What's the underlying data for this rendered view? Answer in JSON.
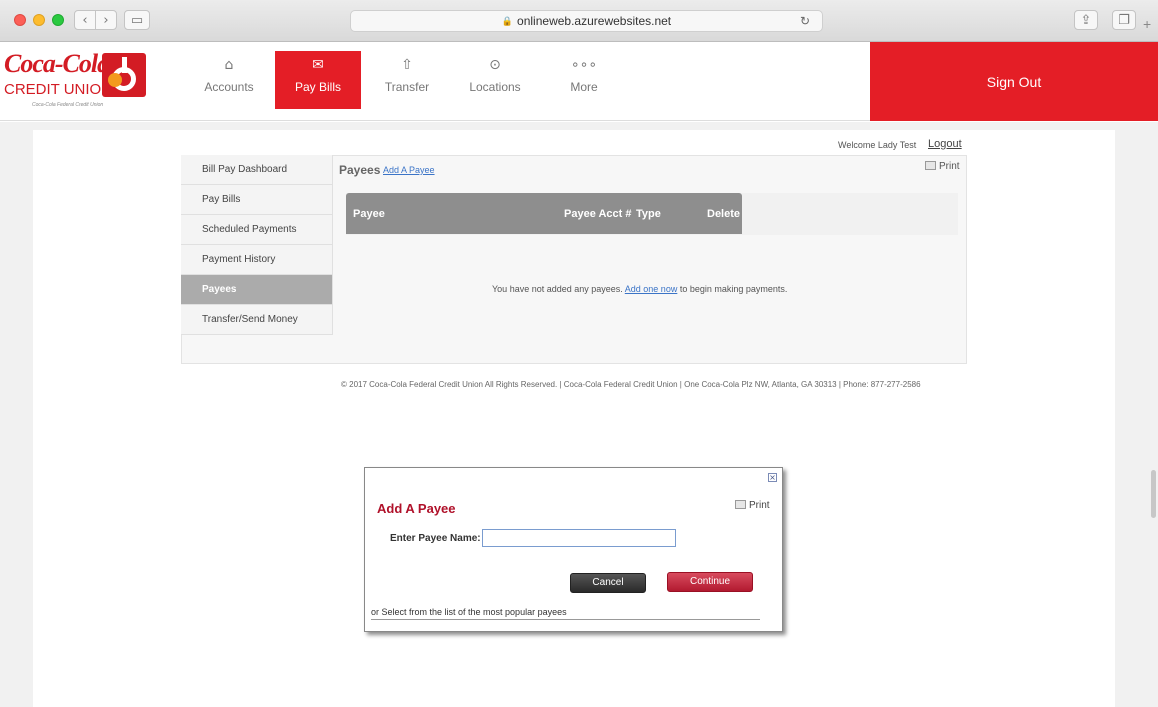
{
  "browser": {
    "url": "onlineweb.azurewebsites.net"
  },
  "header": {
    "logo_script": "Coca-Cola",
    "logo_cu": "CREDIT UNION",
    "logo_fcu": "Coca-Cola Federal Credit Union",
    "nav": [
      {
        "label": "Accounts",
        "icon": "home-icon"
      },
      {
        "label": "Pay Bills",
        "icon": "envelope-icon"
      },
      {
        "label": "Transfer",
        "icon": "upload-icon"
      },
      {
        "label": "Locations",
        "icon": "location-pin-icon"
      },
      {
        "label": "More",
        "icon": "more-dots-icon"
      }
    ],
    "sign_out": "Sign Out",
    "brand_color": "#e41e26"
  },
  "user": {
    "welcome": "Welcome Lady Test",
    "logout": "Logout"
  },
  "sidebar": {
    "items": [
      {
        "label": "Bill Pay Dashboard"
      },
      {
        "label": "Pay Bills"
      },
      {
        "label": "Scheduled Payments"
      },
      {
        "label": "Payment History"
      },
      {
        "label": "Payees",
        "active": true
      },
      {
        "label": "Transfer/Send Money"
      }
    ]
  },
  "main": {
    "title": "Payees",
    "add_payee_link": "Add A Payee",
    "print": "Print",
    "table": {
      "columns": [
        "Payee",
        "Payee Acct #",
        "Type",
        "Delete"
      ]
    },
    "empty_before": "You have not added any payees. ",
    "empty_link": "Add one now",
    "empty_after": " to begin making payments."
  },
  "footer": {
    "text": "© 2017 Coca-Cola Federal Credit Union All Rights Reserved.   |  Coca-Cola Federal Credit Union   |  One Coca-Cola Plz NW, Atlanta, GA 30313   |  Phone: 877-277-2586"
  },
  "modal": {
    "title": "Add A Payee",
    "print": "Print",
    "close": "×",
    "payee_label": "Enter Payee Name:",
    "payee_value": "",
    "cancel": "Cancel",
    "continue": "Continue",
    "popular_text": "or Select from the list of the most popular payees"
  }
}
